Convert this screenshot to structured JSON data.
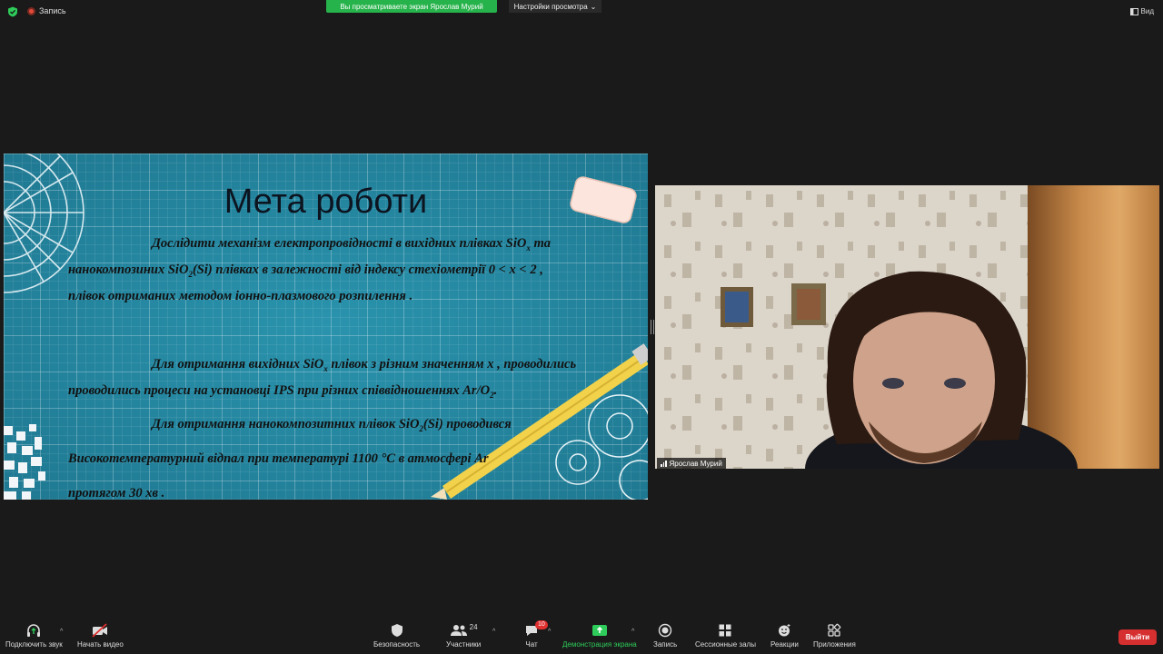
{
  "topbar": {
    "recording_label": "Запись",
    "viewing_banner": "Вы просматриваете экран Ярослав Мурий",
    "view_options": "Настройки просмотра",
    "view_button": "Вид"
  },
  "slide": {
    "title": "Мета роботи",
    "p1_line1": "Дослідити механізм електропровідності в вихідних плівках SiO",
    "p1_line1_sub": "x",
    "p1_line1_end": "  та",
    "p1_line2a": "нанокомпозиних SiO",
    "p1_line2_sub": "2",
    "p1_line2b": "(Si) плівках в залежності від індексу стехіометрії 0 < x < 2 ,",
    "p1_line3": "плівок отриманих методом іонно-плазмового розпилення .",
    "p2_line1a": "Для отримання вихідних  SiO",
    "p2_line1_sub": "x",
    "p2_line1b": "  плівок з різним значенням x , проводились",
    "p2_line2a": "проводились процеси на установці IPS при різних  співвідношеннях Ar/O",
    "p2_line2_sub": "2",
    "p2_line2b": ".",
    "p3_line1a": "Для отримання нанокомпозитних плівок  SiO",
    "p3_line1_sub": "2",
    "p3_line1b": "(Si) проводився",
    "p3_line2": "Високотемпературний відпал при температурі 1100 °С в атмосфері Ar",
    "p3_line3": "протягом 30 хв ."
  },
  "video": {
    "participant_name": "Ярослав Мурий"
  },
  "toolbar": {
    "audio_label": "Подключить звук",
    "video_label": "Начать видео",
    "security_label": "Безопасность",
    "participants_label": "Участники",
    "participants_count": "24",
    "chat_label": "Чат",
    "chat_badge": "10",
    "share_label": "Демонстрация экрана",
    "record_label": "Запись",
    "breakout_label": "Сессионные залы",
    "reactions_label": "Реакции",
    "apps_label": "Приложения",
    "leave_label": "Выйти"
  },
  "colors": {
    "background": "#1a1a1a",
    "banner_green": "#27b34b",
    "leave_red": "#d62f2f",
    "slide_teal": "#2486a0"
  },
  "icons": [
    "shield-icon",
    "record-dot-icon",
    "chevron-down-icon",
    "view-icon",
    "headphones-icon",
    "video-off-icon",
    "security-shield-icon",
    "participants-icon",
    "chat-icon",
    "share-screen-icon",
    "record-icon",
    "breakout-rooms-icon",
    "reactions-icon",
    "apps-icon",
    "signal-icon"
  ]
}
